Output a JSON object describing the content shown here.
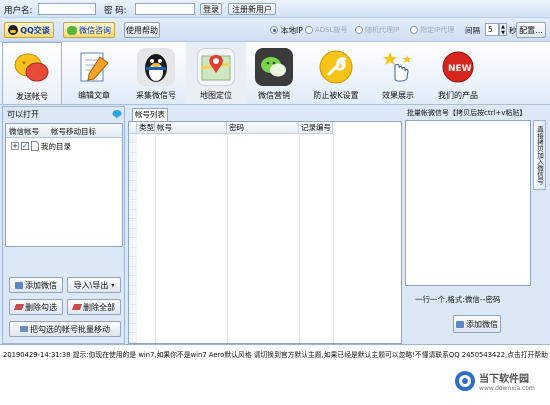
{
  "login": {
    "username_label": "用户名:",
    "password_label": "密  码:",
    "login_button": "登录",
    "register_button": "注册新用户"
  },
  "bar2": {
    "qq_button": "QQ交谈",
    "wechat_button": "微信咨询",
    "help_button": "使用帮助",
    "radio_local": "本地IP",
    "radio_2": "ADSL拨号",
    "radio_3": "随机代理IP",
    "radio_4": "指定IP代理",
    "interval_label": "间隔",
    "interval_value": "5",
    "unit_label": "秒",
    "config_button": "配置..."
  },
  "toolbar": {
    "items": [
      {
        "label": "发送帐号",
        "icon": "chat-bubbles-icon"
      },
      {
        "label": "编辑文章",
        "icon": "notepad-pencil-icon"
      },
      {
        "label": "采集微信号",
        "icon": "penguin-icon"
      },
      {
        "label": "地图定位",
        "icon": "map-pin-icon"
      },
      {
        "label": "微信营销",
        "icon": "wechat-icon"
      },
      {
        "label": "防止被K设置",
        "icon": "wrench-icon"
      },
      {
        "label": "效果展示",
        "icon": "pointer-stars-icon"
      },
      {
        "label": "我们的产品",
        "icon": "new-badge-icon"
      }
    ]
  },
  "left": {
    "title": "可以打开",
    "tab1": "微信帐号",
    "tab2": "帐号移动目标",
    "tree_item": "我的目录",
    "add_button": "添加微信",
    "import_button": "导入\\导出",
    "delete_checked": "删除勾选",
    "delete_all": "删除全部",
    "move_button": "把勾选的帐号批量移动"
  },
  "middle": {
    "tab": "帐号列表",
    "columns": [
      "类型",
      "帐号",
      "密码",
      "记录编号"
    ]
  },
  "right": {
    "title": "批量帐微信号【拷贝后按ctrl+v粘贴】",
    "side_tab": "直接拷贝加入微信号",
    "hint": "一行一个,格式:微信--密码",
    "add_button": "添加微信"
  },
  "status": {
    "text": "20190429-14:31:38  提示:你现在使用的是 win7,如果你不是win7 Aero默认风格 请切换到官方默认主题,如果已经是默认主题可以忽略!不懂请联系QQ 2450543422,点击打开帮助"
  },
  "watermark": {
    "name": "当下软件园",
    "url": "www.downxia.com"
  }
}
